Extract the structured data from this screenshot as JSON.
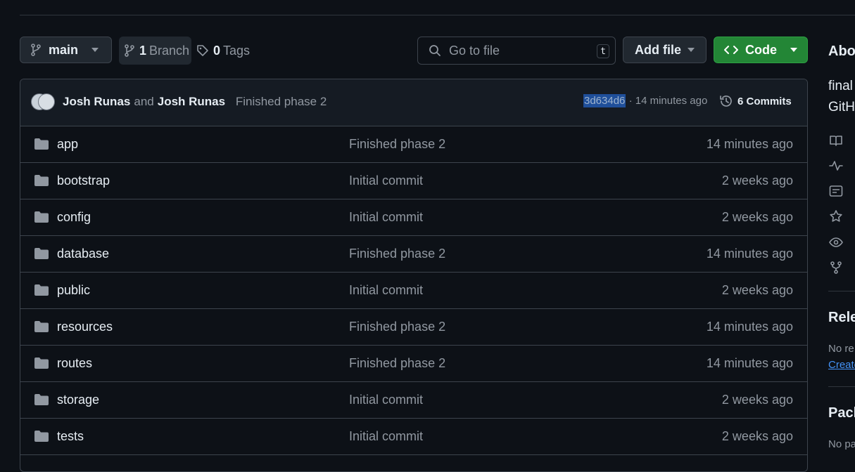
{
  "toolbar": {
    "branch_name": "main",
    "branch_count": "1",
    "branch_label": "Branch",
    "tag_count": "0",
    "tag_label": "Tags",
    "search_placeholder": "Go to file",
    "search_shortcut": "t",
    "add_file_label": "Add file",
    "code_label": "Code"
  },
  "latest_commit": {
    "author1": "Josh Runas",
    "and": "and",
    "author2": "Josh Runas",
    "message": "Finished phase 2",
    "sha": "3d634d6",
    "time": "· 14 minutes ago",
    "commits_count": "6 Commits"
  },
  "files": [
    {
      "name": "app",
      "message": "Finished phase 2",
      "age": "14 minutes ago"
    },
    {
      "name": "bootstrap",
      "message": "Initial commit",
      "age": "2 weeks ago"
    },
    {
      "name": "config",
      "message": "Initial commit",
      "age": "2 weeks ago"
    },
    {
      "name": "database",
      "message": "Finished phase 2",
      "age": "14 minutes ago"
    },
    {
      "name": "public",
      "message": "Initial commit",
      "age": "2 weeks ago"
    },
    {
      "name": "resources",
      "message": "Finished phase 2",
      "age": "14 minutes ago"
    },
    {
      "name": "routes",
      "message": "Finished phase 2",
      "age": "14 minutes ago"
    },
    {
      "name": "storage",
      "message": "Initial commit",
      "age": "2 weeks ago"
    },
    {
      "name": "tests",
      "message": "Initial commit",
      "age": "2 weeks ago"
    }
  ],
  "sidebar": {
    "about_heading": "Abo",
    "desc_line1": "final",
    "desc_line2": "GitH",
    "icons": [
      "book-icon",
      "pulse-icon",
      "note-icon",
      "star-icon",
      "eye-icon",
      "fork-icon"
    ],
    "releases_heading": "Rele",
    "releases_text": "No re",
    "releases_link": "Create",
    "packages_heading": "Pack",
    "packages_text": "No pa"
  },
  "colors": {
    "background": "#0d1117",
    "border": "#3d444d",
    "code_button": "#238636",
    "link": "#4493f8",
    "sha_highlight": "#1f4f9a"
  }
}
